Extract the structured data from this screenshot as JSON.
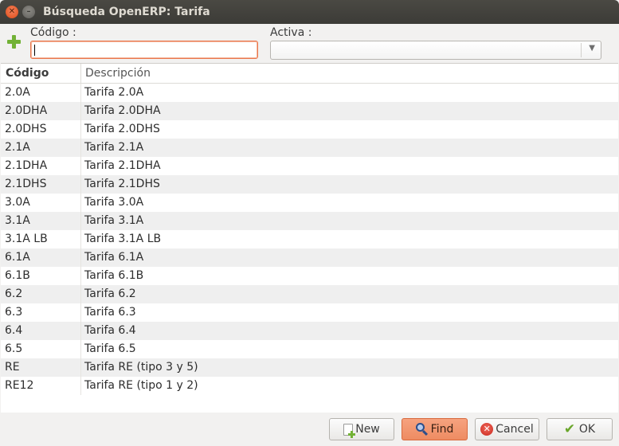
{
  "window": {
    "title": "Búsqueda OpenERP: Tarifa"
  },
  "icons": {
    "close": "close-icon",
    "minimize": "minimize-icon",
    "add": "plus-icon"
  },
  "filters": {
    "codigo_label": "Código :",
    "codigo_value": "",
    "activa_label": "Activa :",
    "activa_value": ""
  },
  "table": {
    "columns": [
      "Código",
      "Descripción"
    ],
    "rows": [
      [
        "2.0A",
        "Tarifa 2.0A"
      ],
      [
        "2.0DHA",
        "Tarifa 2.0DHA"
      ],
      [
        "2.0DHS",
        "Tarifa 2.0DHS"
      ],
      [
        "2.1A",
        "Tarifa 2.1A"
      ],
      [
        "2.1DHA",
        "Tarifa 2.1DHA"
      ],
      [
        "2.1DHS",
        "Tarifa 2.1DHS"
      ],
      [
        "3.0A",
        "Tarifa 3.0A"
      ],
      [
        "3.1A",
        "Tarifa 3.1A"
      ],
      [
        "3.1A LB",
        "Tarifa 3.1A LB"
      ],
      [
        "6.1A",
        "Tarifa 6.1A"
      ],
      [
        "6.1B",
        "Tarifa 6.1B"
      ],
      [
        "6.2",
        "Tarifa 6.2"
      ],
      [
        "6.3",
        "Tarifa 6.3"
      ],
      [
        "6.4",
        "Tarifa 6.4"
      ],
      [
        "6.5",
        "Tarifa 6.5"
      ],
      [
        "RE",
        "Tarifa RE (tipo 3 y 5)"
      ],
      [
        "RE12",
        "Tarifa RE (tipo 1 y 2)"
      ]
    ]
  },
  "buttons": {
    "new": "New",
    "find": "Find",
    "cancel": "Cancel",
    "ok": "OK"
  },
  "colors": {
    "accent": "#ee8c62",
    "focus_border": "#e9764c",
    "add_green": "#72b135"
  }
}
